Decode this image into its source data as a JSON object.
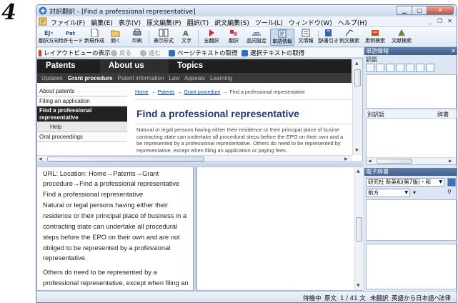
{
  "step_number": "4",
  "window": {
    "title": "対訳翻訳 - [Find a professional representative]",
    "controls": [
      "minimize",
      "maximize",
      "close"
    ]
  },
  "menu": [
    "ファイル(F)",
    "編集(E)",
    "表示(V)",
    "原文編集(P)",
    "翻訳(T)",
    "訳文編集(S)",
    "ツール(L)",
    "ウィンドウ(W)",
    "ヘルプ(H)"
  ],
  "toolbar": [
    {
      "label": "翻訳方向",
      "icon": "ej-direction-icon",
      "top": "EJ"
    },
    {
      "label": "特許モード",
      "icon": "pat-mode-icon",
      "top": "Pat"
    },
    {
      "label": "新規作成",
      "icon": "new-document-icon"
    },
    {
      "label": "開く",
      "icon": "open-folder-icon"
    },
    {
      "label": "印刷",
      "icon": "print-icon"
    },
    {
      "label": "表示形式",
      "icon": "view-format-icon"
    },
    {
      "label": "文字",
      "icon": "font-icon"
    },
    {
      "label": "全翻訳",
      "icon": "translate-all-icon"
    },
    {
      "label": "翻訳",
      "icon": "translate-icon"
    },
    {
      "label": "品詞設定",
      "icon": "part-of-speech-icon"
    },
    {
      "label": "単語情報",
      "icon": "word-info-icon",
      "active": true
    },
    {
      "label": "文情報",
      "icon": "sentence-info-icon"
    },
    {
      "label": "辞書引き",
      "icon": "dictionary-lookup-icon"
    },
    {
      "label": "例文検索",
      "icon": "example-search-icon"
    },
    {
      "label": "用例検索",
      "icon": "usage-search-icon"
    },
    {
      "label": "文献検索",
      "icon": "literature-search-icon"
    }
  ],
  "address_bar": {
    "layout_view": "レイアウトビューの表示",
    "back": "戻る",
    "forward": "進む",
    "get_page_text": "ページテキストの取得",
    "get_selected_text": "選択テキストの取得"
  },
  "web": {
    "nav_tabs": [
      "Patents",
      "About us",
      "Topics"
    ],
    "sub_nav": [
      "Updates",
      "Grant procedure",
      "Patent information",
      "Law",
      "Appeals",
      "Learning"
    ],
    "sub_nav_active": "Grant procedure",
    "side_nav": [
      "About patents",
      "Filing an application",
      "Find a professional representative",
      "Help",
      "Oral proceedings"
    ],
    "breadcrumb": {
      "home": "Home",
      "patents": "Patents",
      "grant": "Grant procedure",
      "current": "Find a professional representative",
      "sep": "→"
    },
    "heading": "Find a professional representative",
    "paragraph_lines": [
      "Natural or legal persons having either their residence or their principal place of busine",
      "contracting state can undertake all procedural steps before the EPO on their own and a",
      "be represented by a professional representative. Others do need to be represented by",
      "representative, except when filing an application or paying fees."
    ]
  },
  "source_text_lines": [
    "URL: Location: Home→Patents→Grant",
    "procedure→Find a professional representative",
    "Find a professional representative",
    "Natural or legal persons having either their",
    "residence or their principal place of business in a",
    "contracting state can undertake all procedural",
    "steps before the EPO on their own and are not",
    "obliged to be represented by a professional",
    "representative.",
    "Others do need to be represented by a",
    "professional representative, except when filing an"
  ],
  "side_panel": {
    "word_info": {
      "title": "単語情報",
      "word_label": "訳語",
      "col_alt_word": "別訳語",
      "col_dictionary": "辞書"
    },
    "e_dictionary": {
      "title": "電子辞書",
      "dictionary_select": "研究社 新英和(第7版)・和",
      "direction_select": "前方"
    }
  },
  "status": {
    "state": "待機中",
    "source_label": "原文",
    "position": "1 / 41 文",
    "translation_state": "未翻訳",
    "direction": "英語から日本語へ",
    "field": "法律"
  },
  "colors": {
    "web_nav_dark": "#1f1f1f",
    "web_heading": "#1b3a78",
    "panel_header": "#3f5f8c",
    "window_frame": "#dbe6f3"
  }
}
